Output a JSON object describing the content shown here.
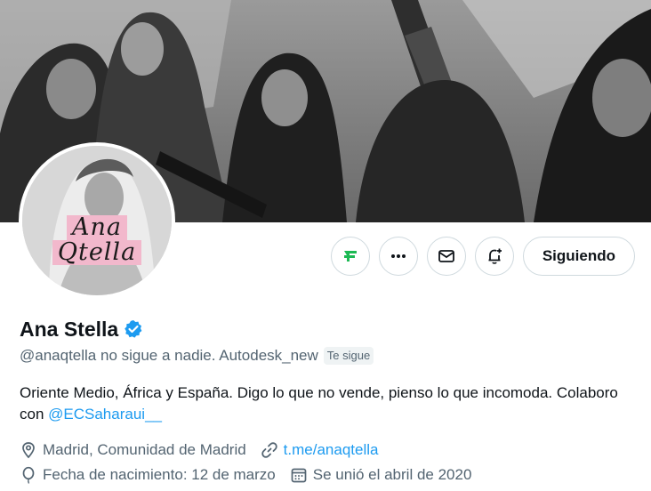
{
  "banner": {
    "alt_icon": "photo-banner"
  },
  "avatar": {
    "caption_line1": "Ana",
    "caption_line2": "Qtella"
  },
  "actions": {
    "grok_icon": "grok-icon",
    "more_icon": "more-icon",
    "message_icon": "message-icon",
    "notify_icon": "bell-plus-icon",
    "follow_label": "Siguiendo"
  },
  "profile": {
    "display_name": "Ana Stella",
    "verified_icon": "verified-badge-icon",
    "handle_line": "@anaqtella no sigue a nadie. Autodesk_new",
    "follows_you_badge": "Te sigue",
    "bio_text": "Oriente Medio, África y España. Digo lo que no vende, pienso lo que incomoda. Colaboro con ",
    "bio_mention": "@ECSaharaui__",
    "location": "Madrid, Comunidad de Madrid",
    "website": "t.me/anaqtella",
    "birthday": "Fecha de nacimiento: 12 de marzo",
    "joined": "Se unió el abril de 2020"
  },
  "colors": {
    "accent": "#1d9bf0",
    "text": "#0f1419",
    "secondary_text": "#536471",
    "border": "#cfd9de",
    "grok_green": "#1db954"
  }
}
